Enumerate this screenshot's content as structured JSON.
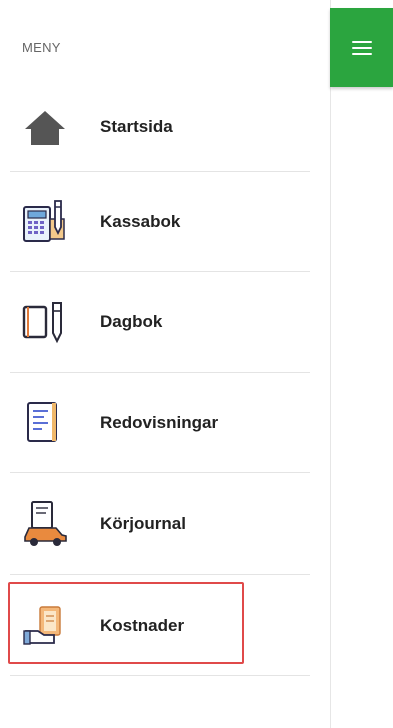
{
  "menu": {
    "heading": "MENY",
    "items": [
      {
        "label": "Startsida",
        "icon": "home-icon"
      },
      {
        "label": "Kassabok",
        "icon": "cashbook-icon"
      },
      {
        "label": "Dagbok",
        "icon": "journal-icon"
      },
      {
        "label": "Redovisningar",
        "icon": "report-icon"
      },
      {
        "label": "Körjournal",
        "icon": "car-log-icon"
      },
      {
        "label": "Kostnader",
        "icon": "costs-icon"
      }
    ]
  },
  "header": {
    "menu_button_icon": "hamburger-icon",
    "accent_color": "#2ba53f"
  },
  "highlight": {
    "target": "Kostnader",
    "color": "#e04a4a"
  }
}
